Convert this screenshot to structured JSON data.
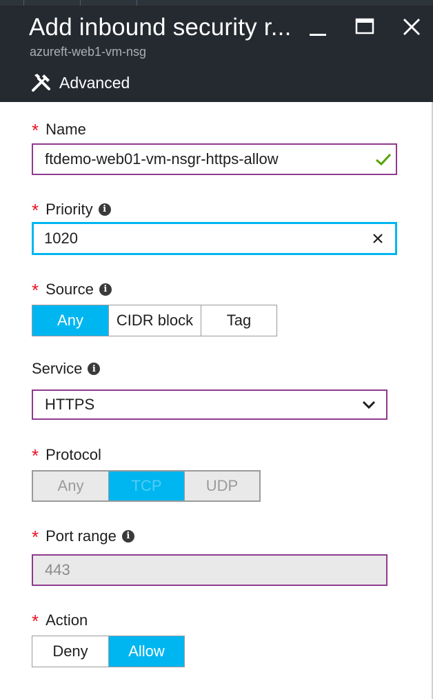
{
  "blade": {
    "title": "Add inbound security r...",
    "subtitle": "azureft-web1-vm-nsg",
    "advanced_label": "Advanced"
  },
  "fields": {
    "name": {
      "label": "Name",
      "value": "ftdemo-web01-vm-nsgr-https-allow",
      "required": true,
      "status": "valid"
    },
    "priority": {
      "label": "Priority",
      "value": "1020",
      "required": true
    },
    "source": {
      "label": "Source",
      "required": true,
      "options": [
        "Any",
        "CIDR block",
        "Tag"
      ],
      "selected": "Any"
    },
    "service": {
      "label": "Service",
      "value": "HTTPS"
    },
    "protocol": {
      "label": "Protocol",
      "required": true,
      "options": [
        "Any",
        "TCP",
        "UDP"
      ],
      "selected": "TCP",
      "disabled": true
    },
    "port_range": {
      "label": "Port range",
      "value": "443",
      "required": true,
      "disabled": true
    },
    "action": {
      "label": "Action",
      "required": true,
      "options": [
        "Deny",
        "Allow"
      ],
      "selected": "Allow"
    }
  },
  "required_marker": "*",
  "info_glyph": "i",
  "icons": {
    "advanced": "wrench-screwdriver-icon",
    "minimize": "minimize-icon",
    "maximize": "maximize-icon",
    "close": "close-icon",
    "valid": "checkmark-icon",
    "clear": "clear-x-icon",
    "dropdown": "chevron-down-icon"
  },
  "colors": {
    "header_bg": "#252a30",
    "accent": "#00b6f0",
    "required": "#e81123",
    "input_border": "#8e3a8e",
    "valid": "#57a300"
  }
}
